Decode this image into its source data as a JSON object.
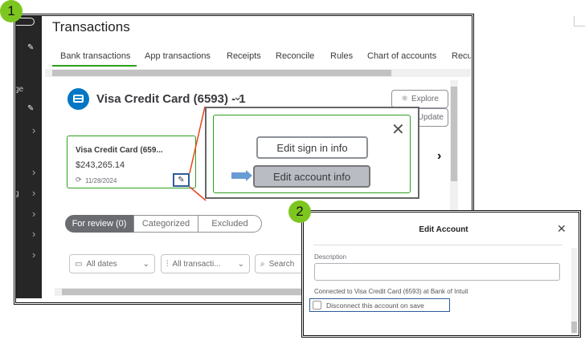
{
  "step_badges": [
    "1",
    "2"
  ],
  "sidebar": {
    "partial_labels": [
      "ge",
      "g"
    ]
  },
  "header": {
    "title": "Transactions"
  },
  "tabs": [
    {
      "label": "Bank transactions",
      "active": true
    },
    {
      "label": "App transactions"
    },
    {
      "label": "Receipts"
    },
    {
      "label": "Reconcile"
    },
    {
      "label": "Rules"
    },
    {
      "label": "Chart of accounts"
    },
    {
      "label": "Recu"
    }
  ],
  "account": {
    "selector_label": "Visa Credit Card (6593) - 1",
    "explore_label": "Explore",
    "update_label": "Update"
  },
  "card": {
    "name": "Visa Credit Card (659...",
    "balance": "$243,265.14",
    "date": "11/28/2024"
  },
  "popup": {
    "edit_sign_in_label": "Edit sign in info",
    "edit_account_label": "Edit account info"
  },
  "review_tabs": [
    {
      "label": "For review (0)",
      "active": true
    },
    {
      "label": "Categorized"
    },
    {
      "label": "Excluded"
    }
  ],
  "filters": {
    "dates": "All dates",
    "transactions": "All transacti...",
    "search_placeholder": "Search"
  },
  "dialog": {
    "title": "Edit Account",
    "description_label": "Description",
    "description_value": "",
    "connected_text": "Connected to Visa Credit Card (6593) at Bank of Intuit",
    "disconnect_label": "Disconnect this account on save",
    "disconnect_checked": false
  },
  "colors": {
    "accent_green": "#2ca01c",
    "badge_green": "#7dc61f",
    "highlight_blue": "#2e5c9a",
    "callout_red": "#e8431a",
    "account_blue": "#0077c5"
  }
}
